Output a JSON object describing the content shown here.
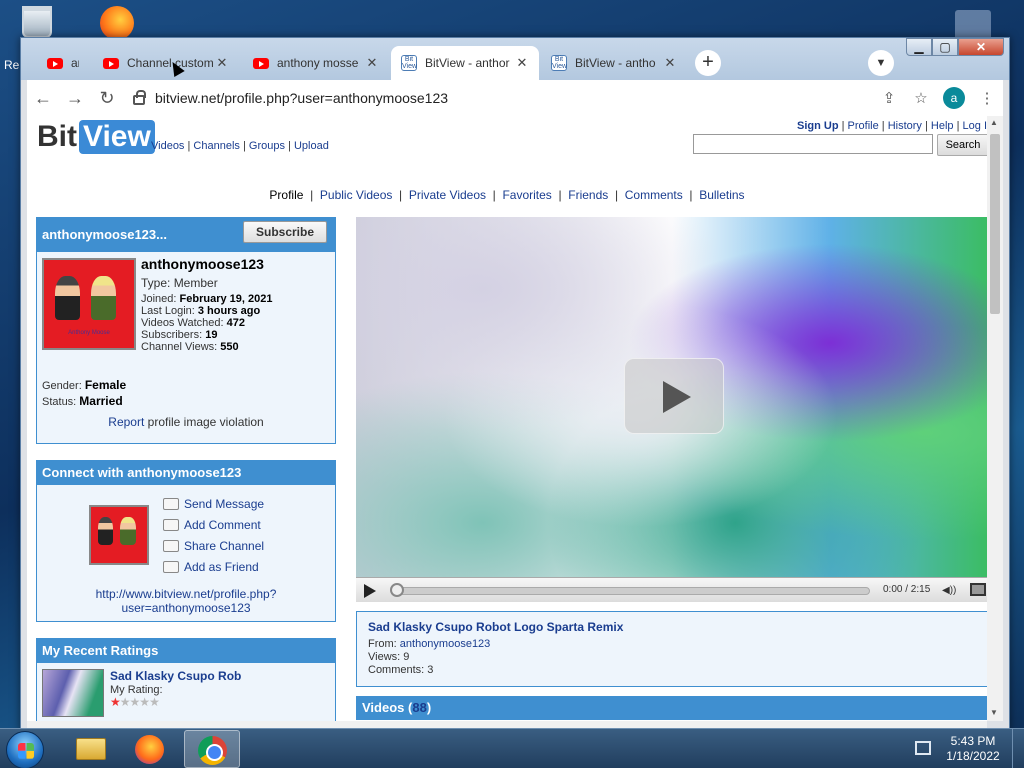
{
  "desktop": {
    "left_edge_label": "Re"
  },
  "browser": {
    "tabs": [
      {
        "title": "an",
        "icon": "youtube-icon"
      },
      {
        "title": "Channel custom",
        "icon": "youtube-icon"
      },
      {
        "title": "anthony mosse",
        "icon": "youtube-icon"
      },
      {
        "title": "BitView - anthor",
        "icon": "bitview-icon",
        "active": true
      },
      {
        "title": "BitView - antho",
        "icon": "bitview-icon"
      }
    ],
    "url": "bitview.net/profile.php?user=anthonymoose123",
    "profile_initial": "a"
  },
  "site": {
    "logo_bit": "Bit",
    "logo_view": "View",
    "nav": {
      "videos": "Videos",
      "channels": "Channels",
      "groups": "Groups",
      "upload": "Upload",
      "sep": " | "
    },
    "user_links": {
      "signup": "Sign Up",
      "profile": "Profile",
      "history": "History",
      "help": "Help",
      "logout": "Log I"
    },
    "search_button": "Search",
    "profile_tabs": [
      "Profile",
      "Public Videos",
      "Private Videos",
      "Favorites",
      "Friends",
      "Comments",
      "Bulletins"
    ]
  },
  "profile_box": {
    "header": "anthonymoose123...",
    "subscribe": "Subscribe",
    "username": "anthonymoose123",
    "type_label": "Type: ",
    "type_value": "Member",
    "joined_label": "Joined: ",
    "joined_value": "February 19, 2021",
    "last_login_label": "Last Login: ",
    "last_login_value": "3 hours ago",
    "watched_label": "Videos Watched: ",
    "watched_value": "472",
    "subs_label": "Subscribers: ",
    "subs_value": "19",
    "views_label": "Channel Views: ",
    "views_value": "550",
    "gender_label": "Gender: ",
    "gender_value": "Female",
    "status_label": "Status: ",
    "status_value": "Married",
    "report_link": "Report",
    "report_rest": " profile image violation",
    "image_caption": "Anthony Moose"
  },
  "connect_box": {
    "header": "Connect with anthonymoose123",
    "actions": [
      "Send Message",
      "Add Comment",
      "Share Channel",
      "Add as Friend"
    ],
    "url_line1": "http://www.bitview.net/profile.php?",
    "url_line2": "user=anthonymoose123"
  },
  "ratings_box": {
    "header": "My Recent Ratings",
    "title": "Sad Klasky Csupo Rob",
    "label": "My Rating:",
    "rating": 1,
    "max_rating": 5
  },
  "player": {
    "time": "0:00 / 2:15",
    "progress": 0
  },
  "video_info": {
    "title": "Sad Klasky Csupo Robot Logo Sparta Remix",
    "from_label": "From: ",
    "from_value": "anthonymoose123",
    "views": "Views: 9",
    "comments": "Comments: 3"
  },
  "videos_section": {
    "label": "Videos (",
    "count": "88",
    "close": ")"
  },
  "taskbar": {
    "time": "5:43 PM",
    "date": "1/18/2022"
  },
  "colors": {
    "accent": "#3f8fd0",
    "link": "#1a3d8f",
    "box_bg": "#eef5fc"
  }
}
